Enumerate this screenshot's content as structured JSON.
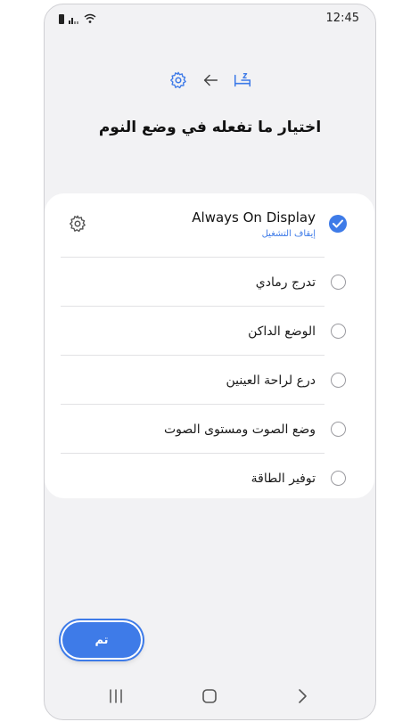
{
  "status_bar": {
    "time": "12:45"
  },
  "header": {
    "title": "اختيار ما تفعله في وضع النوم"
  },
  "options": [
    {
      "label": "Always On Display",
      "sublabel": "إيقاف التشغيل",
      "checked": true
    },
    {
      "label": "تدرج رمادي",
      "checked": false
    },
    {
      "label": "الوضع الداكن",
      "checked": false
    },
    {
      "label": "درع لراحة العينين",
      "checked": false
    },
    {
      "label": "وضع الصوت ومستوى الصوت",
      "checked": false
    },
    {
      "label": "توفير الطاقة",
      "checked": false
    }
  ],
  "done_button": {
    "label": "تم"
  },
  "colors": {
    "accent": "#3e7be8",
    "background": "#f2f2f4",
    "card": "#ffffff"
  },
  "icons": [
    "settings-icon",
    "back-arrow-icon",
    "bed-icon",
    "gear-icon",
    "recents-icon",
    "home-icon",
    "nav-back-icon"
  ]
}
